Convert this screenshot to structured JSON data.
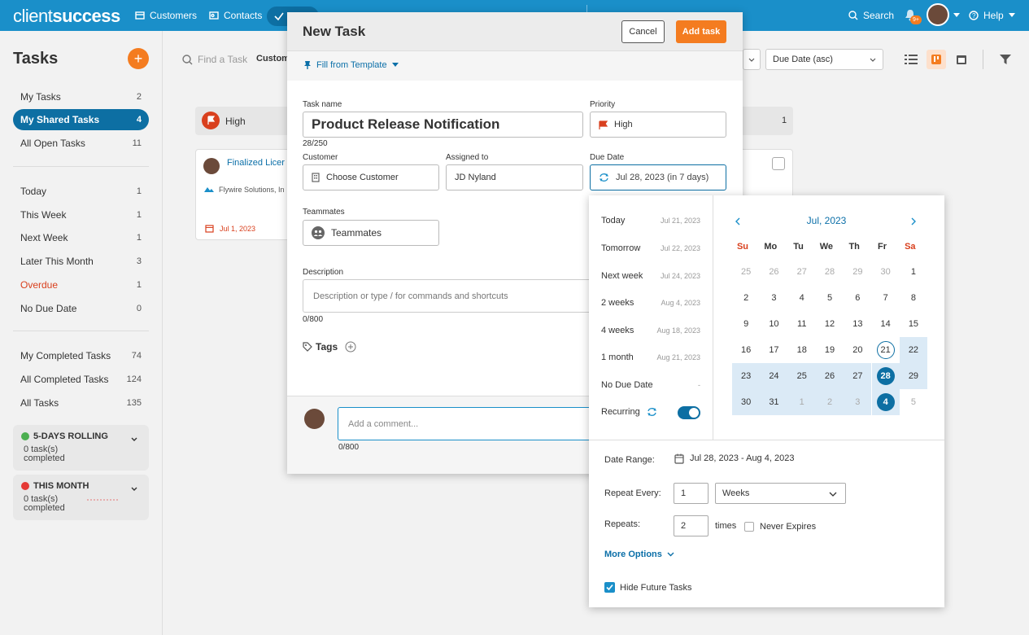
{
  "app": {
    "logo_light": "client",
    "logo_bold": "success"
  },
  "nav": {
    "customers": "Customers",
    "contacts": "Contacts",
    "search": "Search",
    "notif_badge": "9+",
    "help": "Help"
  },
  "sidebar": {
    "title": "Tasks",
    "add": "+",
    "group1": [
      {
        "label": "My Tasks",
        "count": "2"
      },
      {
        "label": "My Shared Tasks",
        "count": "4"
      },
      {
        "label": "All Open Tasks",
        "count": "11"
      }
    ],
    "group2": [
      {
        "label": "Today",
        "count": "1"
      },
      {
        "label": "This Week",
        "count": "1"
      },
      {
        "label": "Next Week",
        "count": "1"
      },
      {
        "label": "Later This Month",
        "count": "3"
      },
      {
        "label": "Overdue",
        "count": "1"
      },
      {
        "label": "No Due Date",
        "count": "0"
      }
    ],
    "group3": [
      {
        "label": "My Completed Tasks",
        "count": "74"
      },
      {
        "label": "All Completed Tasks",
        "count": "124"
      },
      {
        "label": "All Tasks",
        "count": "135"
      }
    ],
    "widgets": [
      {
        "title": "5-DAYS ROLLING",
        "line1": "0 task(s)",
        "line2": "completed",
        "dot_color": "#4caf50"
      },
      {
        "title": "THIS MONTH",
        "line1": "0 task(s)",
        "line2": "completed",
        "dot_color": "#e53935"
      }
    ]
  },
  "main": {
    "search_placeholder": "Find a Task",
    "customer_filter": "Custom",
    "sort_value": "Due Date (asc)",
    "column": {
      "priority": "High",
      "count": "1"
    },
    "card": {
      "title": "Finalized Licer",
      "company": "Flywire Solutions, In",
      "date": "Jul 1, 2023"
    }
  },
  "modal": {
    "title": "New Task",
    "cancel": "Cancel",
    "add": "Add task",
    "template": "Fill from Template",
    "task_name_label": "Task name",
    "task_name": "Product Release Notification",
    "task_name_count": "28/250",
    "priority_label": "Priority",
    "priority": "High",
    "customer_label": "Customer",
    "customer": "Choose Customer",
    "assigned_label": "Assigned to",
    "assigned": "JD Nyland",
    "due_label": "Due Date",
    "due": "Jul 28, 2023 (in 7 days)",
    "teammates_label": "Teammates",
    "teammates": "Teammates",
    "description_label": "Description",
    "description_placeholder": "Description or type / for commands and shortcuts",
    "description_count": "0/800",
    "tags": "Tags",
    "comment_placeholder": "Add a comment...",
    "comment_count": "0/800"
  },
  "datepicker": {
    "quick": [
      {
        "label": "Today",
        "date": "Jul 21, 2023"
      },
      {
        "label": "Tomorrow",
        "date": "Jul 22, 2023"
      },
      {
        "label": "Next week",
        "date": "Jul 24, 2023"
      },
      {
        "label": "2 weeks",
        "date": "Aug 4, 2023"
      },
      {
        "label": "4 weeks",
        "date": "Aug 18, 2023"
      },
      {
        "label": "1 month",
        "date": "Aug 21, 2023"
      },
      {
        "label": "No Due Date",
        "date": "-"
      }
    ],
    "recurring": "Recurring",
    "recurring_on": true,
    "month": "Jul, 2023",
    "dow": [
      "Su",
      "Mo",
      "Tu",
      "We",
      "Th",
      "Fr",
      "Sa"
    ],
    "weeks": [
      [
        "25",
        "26",
        "27",
        "28",
        "29",
        "30",
        "1"
      ],
      [
        "2",
        "3",
        "4",
        "5",
        "6",
        "7",
        "8"
      ],
      [
        "9",
        "10",
        "11",
        "12",
        "13",
        "14",
        "15"
      ],
      [
        "16",
        "17",
        "18",
        "19",
        "20",
        "21",
        "22"
      ],
      [
        "23",
        "24",
        "25",
        "26",
        "27",
        "28",
        "29"
      ],
      [
        "30",
        "31",
        "1",
        "2",
        "3",
        "4",
        "5"
      ]
    ],
    "date_range_label": "Date Range:",
    "date_range": "Jul 28, 2023 - Aug 4, 2023",
    "repeat_every_label": "Repeat Every:",
    "repeat_every": "1",
    "repeat_unit": "Weeks",
    "repeats_label": "Repeats:",
    "repeats": "2",
    "times": "times",
    "never_expires": "Never Expires",
    "more_options": "More Options",
    "hide_future": "Hide Future Tasks",
    "accent": "#0d6fa3"
  }
}
